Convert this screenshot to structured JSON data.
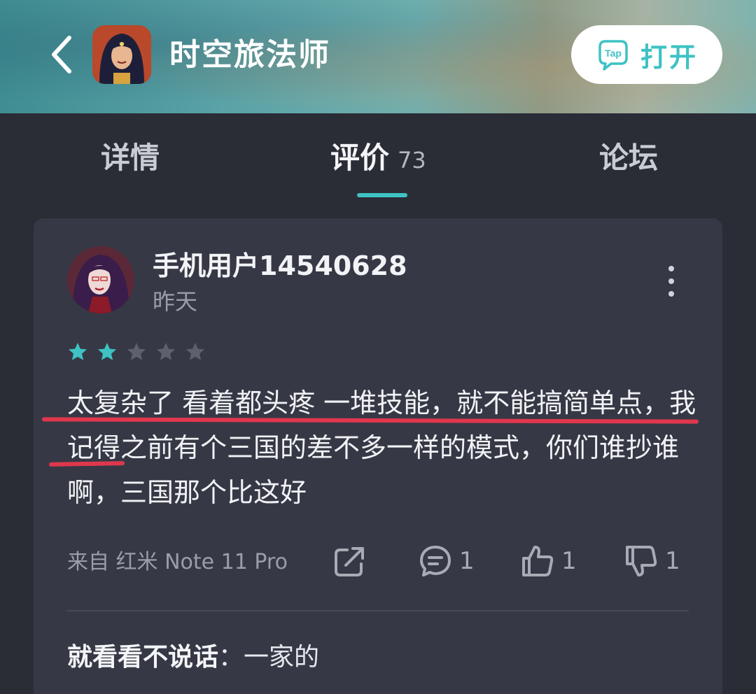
{
  "header": {
    "app_title": "时空旅法师",
    "open_button": "打开",
    "tap_logo_text": "Tap"
  },
  "tabs": [
    {
      "label": "详情"
    },
    {
      "label": "评价",
      "count": "73",
      "active": true
    },
    {
      "label": "论坛"
    }
  ],
  "review": {
    "username": "手机用户14540628",
    "time": "昨天",
    "rating": 2,
    "max_rating": 5,
    "text": "太复杂了 看着都头疼 一堆技能，就不能搞简单点，我记得之前有个三国的差不多一样的模式，你们谁抄谁啊，三国那个比这好",
    "device": "来自 红米 Note 11 Pro",
    "comments_count": "1",
    "likes_count": "1",
    "dislikes_count": "1"
  },
  "reply": {
    "user": "就看看不说话",
    "separator": "：",
    "text": "一家的"
  },
  "colors": {
    "accent": "#3ec2c4",
    "background": "#2a2c36",
    "card": "#363945",
    "annotation_underline": "#e0374d"
  },
  "icons": {
    "back": "chevron-left-icon",
    "more": "vertical-dots-icon",
    "share": "share-icon",
    "comment": "comment-icon",
    "like": "thumbs-up-icon",
    "dislike": "thumbs-down-icon"
  }
}
